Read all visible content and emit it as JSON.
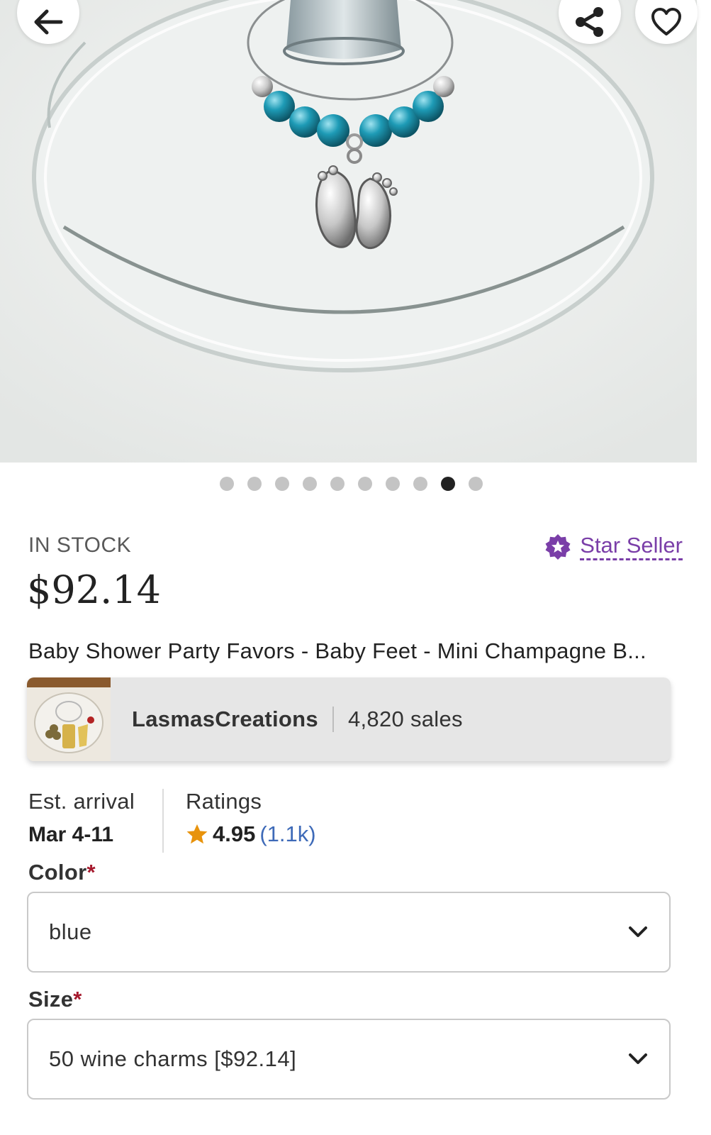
{
  "header": {
    "back_icon": "arrow-left-icon",
    "share_icon": "share-icon",
    "favorite_icon": "heart-outline-icon"
  },
  "carousel": {
    "total": 10,
    "active_index": 8
  },
  "listing": {
    "stock_status": "IN STOCK",
    "star_seller_label": "Star Seller",
    "price": "$92.14",
    "title": "Baby Shower Party Favors - Baby Feet - Mini Champagne B..."
  },
  "shop": {
    "name": "LasmasCreations",
    "sales": "4,820 sales"
  },
  "arrival": {
    "label": "Est. arrival",
    "value": "Mar 4-11"
  },
  "ratings": {
    "label": "Ratings",
    "value": "4.95",
    "count": "(1.1k)"
  },
  "options": {
    "color": {
      "label": "Color",
      "required_mark": "*",
      "value": "blue"
    },
    "size": {
      "label": "Size",
      "required_mark": "*",
      "value": "50 wine charms [$92.14]"
    }
  },
  "colors": {
    "accent_purple": "#7a3ea8",
    "rating_star": "#e8930c",
    "link_blue": "#3e6ab8",
    "required_red": "#a61a2e"
  }
}
